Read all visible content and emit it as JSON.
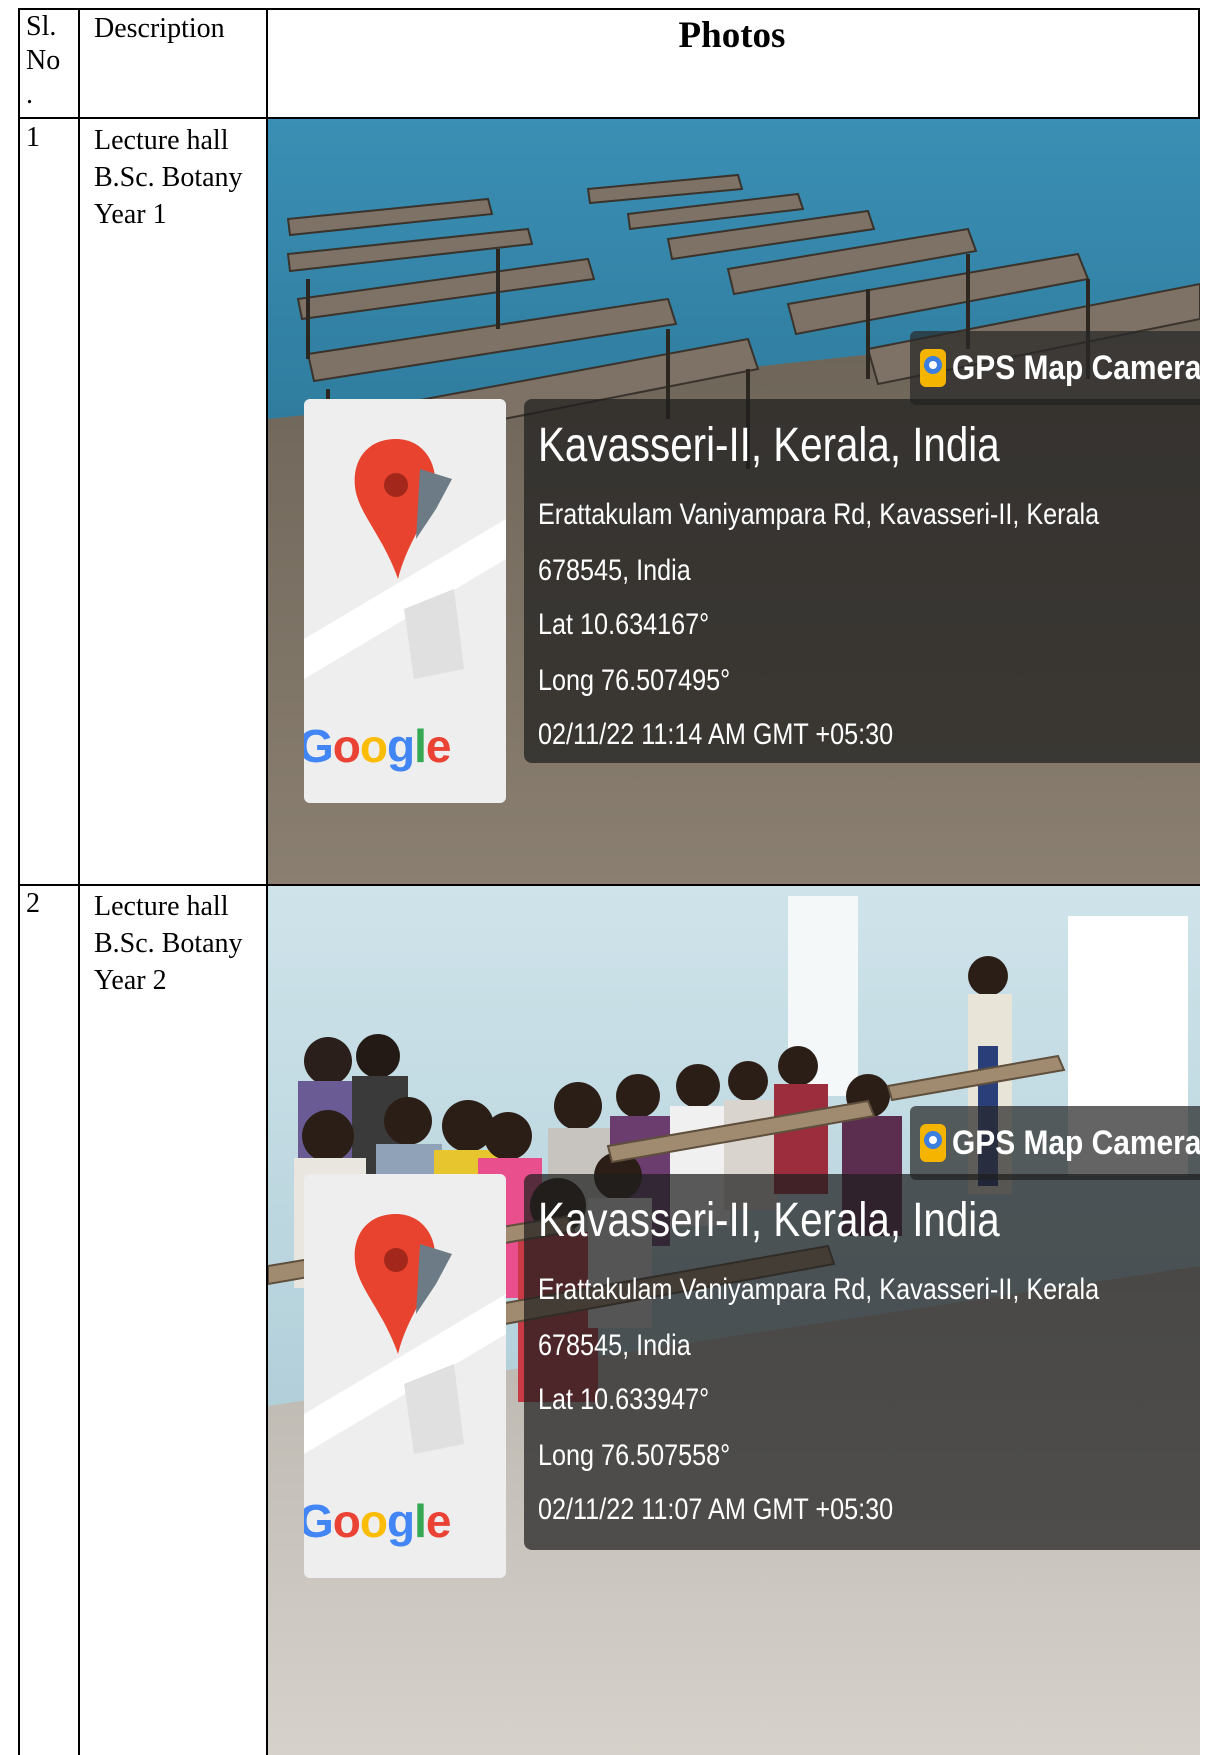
{
  "header": {
    "sl_no": "Sl.\nNo\n.",
    "description": "Description",
    "photos": "Photos"
  },
  "rows": [
    {
      "sl": "1",
      "description": " Lecture hall B.Sc. Botany Year 1",
      "gps_badge": "GPS Map Camera",
      "location_title": "Kavasseri-II, Kerala, India",
      "address_line1": "Erattakulam Vaniyampara Rd, Kavasseri-II, Kerala",
      "address_line2": "678545, India",
      "lat": "Lat 10.634167°",
      "long": "Long 76.507495°",
      "timestamp": "02/11/22 11:14 AM GMT +05:30",
      "map_brand": "Google"
    },
    {
      "sl": "2",
      "description": " Lecture hall B.Sc. Botany Year 2",
      "gps_badge": "GPS Map Camera",
      "location_title": "Kavasseri-II, Kerala, India",
      "address_line1": "Erattakulam Vaniyampara Rd, Kavasseri-II, Kerala",
      "address_line2": "678545, India",
      "lat": "Lat 10.633947°",
      "long": "Long 76.507558°",
      "timestamp": "02/11/22 11:07 AM GMT +05:30",
      "map_brand": "Google"
    }
  ],
  "colors": {
    "wall_blue": "#2f7ea1",
    "map_pin": "#e8432f",
    "overlay": "#1e1e1e"
  }
}
